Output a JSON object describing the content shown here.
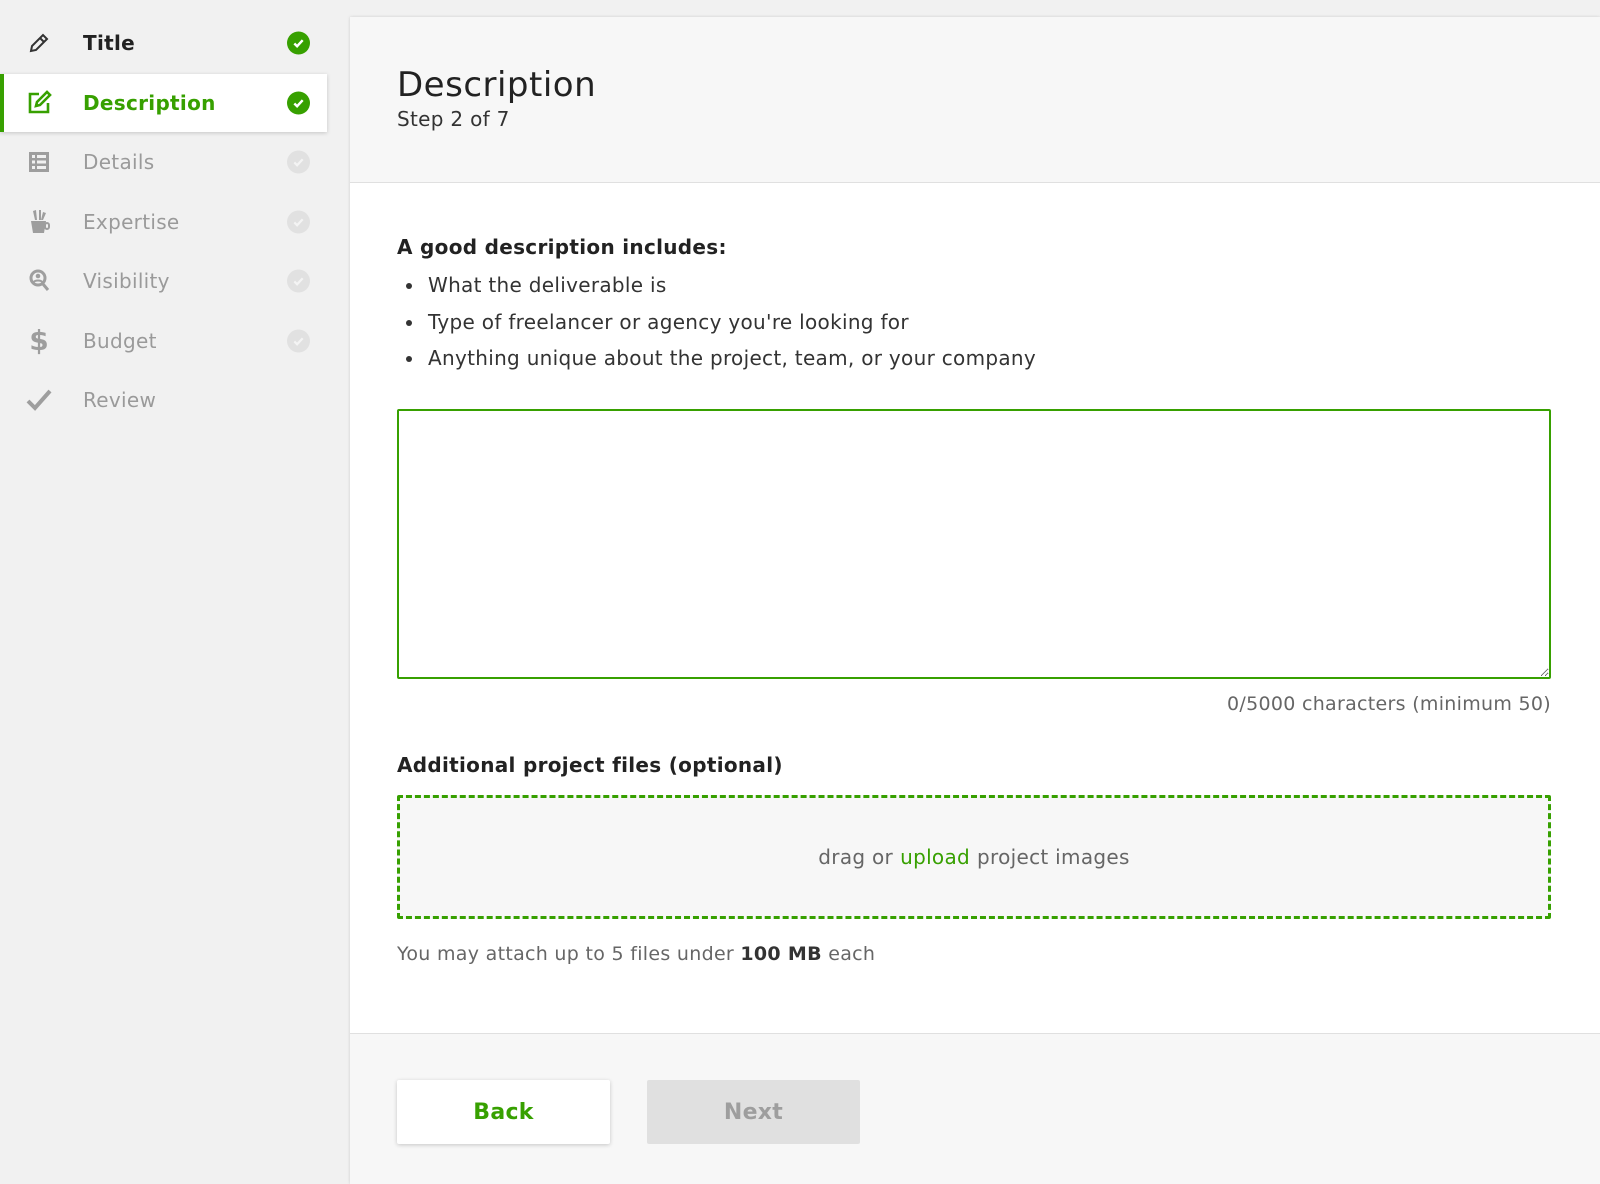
{
  "sidebar": {
    "items": [
      {
        "label": "Title",
        "icon": "pencil-icon",
        "state": "done"
      },
      {
        "label": "Description",
        "icon": "edit-square-icon",
        "state": "active"
      },
      {
        "label": "Details",
        "icon": "list-icon",
        "state": "pending"
      },
      {
        "label": "Expertise",
        "icon": "brushes-cup-icon",
        "state": "pending"
      },
      {
        "label": "Visibility",
        "icon": "person-search-icon",
        "state": "pending"
      },
      {
        "label": "Budget",
        "icon": "dollar-icon",
        "state": "pending"
      },
      {
        "label": "Review",
        "icon": "checkmark-icon",
        "state": "pending"
      }
    ]
  },
  "header": {
    "title": "Description",
    "step": "Step 2 of 7"
  },
  "guide": {
    "heading": "A good description includes:",
    "bullets": [
      "What the deliverable is",
      "Type of freelancer or agency you're looking for",
      "Anything unique about the project, team, or your company"
    ]
  },
  "description_field": {
    "value": "",
    "char_count": "0/5000 characters (minimum 50)"
  },
  "files": {
    "heading": "Additional project files (optional)",
    "drop_prefix": "drag or",
    "drop_link": "upload",
    "drop_suffix": "project images",
    "note_prefix": "You may attach up to 5 files under",
    "note_size": "100 MB",
    "note_suffix": "each"
  },
  "footer": {
    "back_label": "Back",
    "next_label": "Next"
  },
  "colors": {
    "accent": "#37a000",
    "disabled": "#e0e0e0"
  }
}
